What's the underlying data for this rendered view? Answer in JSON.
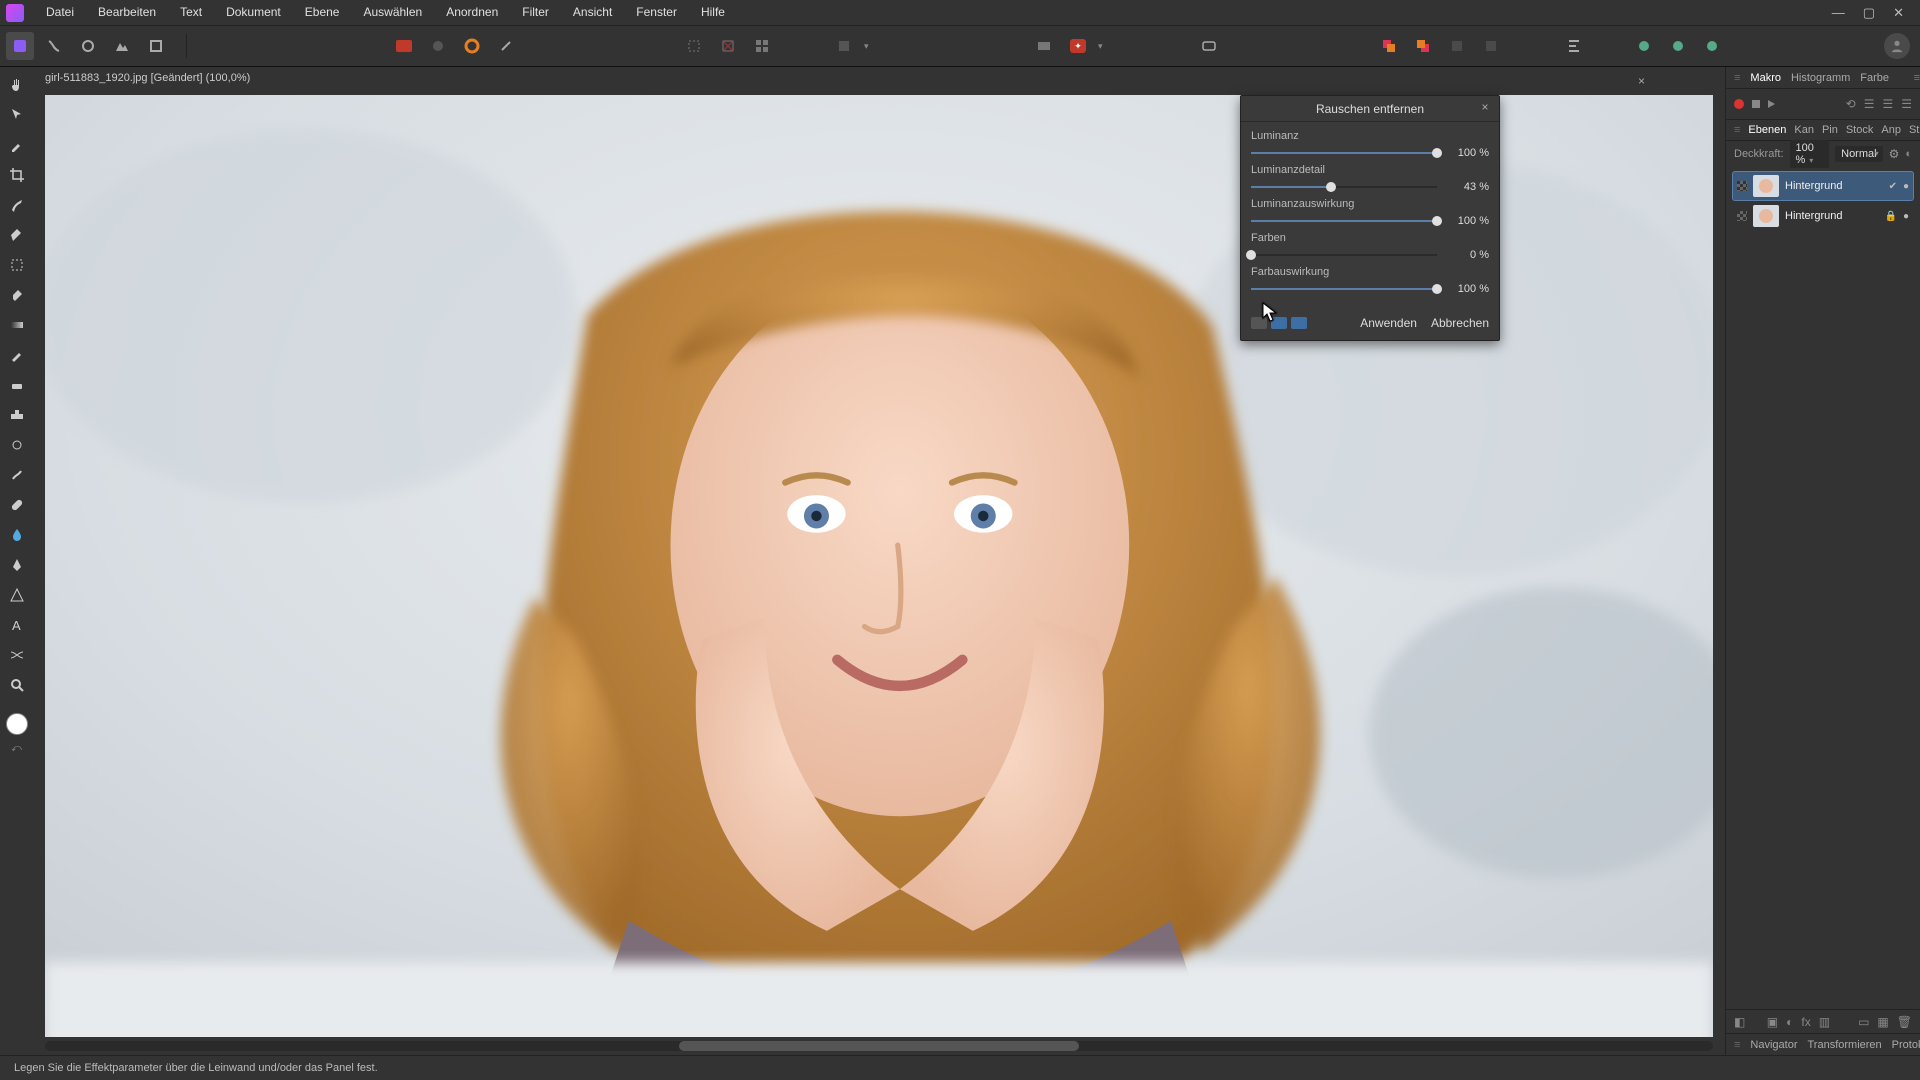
{
  "menu": {
    "items": [
      "Datei",
      "Bearbeiten",
      "Text",
      "Dokument",
      "Ebene",
      "Auswählen",
      "Anordnen",
      "Filter",
      "Ansicht",
      "Fenster",
      "Hilfe"
    ]
  },
  "document": {
    "tab_label": "girl-511883_1920.jpg [Geändert] (100,0%)"
  },
  "dialog": {
    "title": "Rauschen entfernen",
    "rows": [
      {
        "label": "Luminanz",
        "value": "100 %",
        "pct": 100
      },
      {
        "label": "Luminanzdetail",
        "value": "43 %",
        "pct": 43
      },
      {
        "label": "Luminanzauswirkung",
        "value": "100 %",
        "pct": 100
      },
      {
        "label": "Farben",
        "value": "0 %",
        "pct": 0
      },
      {
        "label": "Farbauswirkung",
        "value": "100 %",
        "pct": 100
      }
    ],
    "apply": "Anwenden",
    "cancel": "Abbrechen"
  },
  "right": {
    "tabs1": [
      "Makro",
      "Histogramm",
      "Farbe"
    ],
    "layers_tabs": [
      "Ebenen",
      "Kan",
      "Pin",
      "Stock",
      "Anp",
      "Stil"
    ],
    "opacity_label": "Deckkraft:",
    "opacity_value": "100 %",
    "blend_mode": "Normal",
    "layers": [
      "Hintergrund",
      "Hintergrund"
    ],
    "nav_tabs": [
      "Navigator",
      "Transformieren",
      "Protokoll"
    ]
  },
  "status": "Legen Sie die Effektparameter über die Leinwand und/oder das Panel fest."
}
